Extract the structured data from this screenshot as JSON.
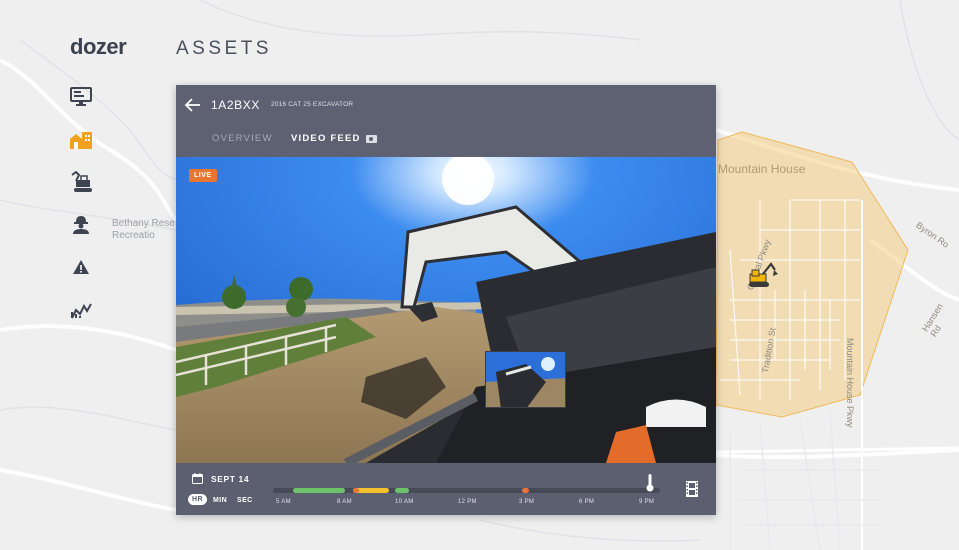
{
  "app": {
    "brand": "dozer",
    "page_title": "ASSETS"
  },
  "nav": {
    "items": [
      {
        "name": "monitor-icon",
        "active": false
      },
      {
        "name": "buildings-icon",
        "active": true
      },
      {
        "name": "excavator-icon",
        "active": false
      },
      {
        "name": "worker-icon",
        "active": false
      },
      {
        "name": "warning-icon",
        "active": false
      },
      {
        "name": "analytics-icon",
        "active": false
      }
    ]
  },
  "map": {
    "labels": {
      "mountain_house": "Mountain House",
      "bethany_1": "Bethany Rese",
      "bethany_2": "Recreatio",
      "byron": "Byron Ro",
      "central_pkwy": "Central Pkwy",
      "hansen": "Hansen Rd",
      "tradition": "Tradition St",
      "mountain_house_pkwy": "Mountain House Pkwy"
    },
    "geofence_color": "#f5c56a",
    "marker_icon": "excavator-marker-icon"
  },
  "panel": {
    "asset_id": "1A2BXX",
    "asset_description": "2016 CAT 25 EXCAVATOR",
    "tabs": {
      "overview": "OVERVIEW",
      "video_feed": "VIDEO FEED"
    },
    "live_badge": "LIVE",
    "timeline": {
      "date": "SEPT 14",
      "units": {
        "hr": "HR",
        "min": "MIN",
        "sec": "SEC"
      },
      "ticks": [
        "5 AM",
        "8 AM",
        "10 AM",
        "12 PM",
        "3 PM",
        "6 PM",
        "9 PM"
      ],
      "colors": {
        "green": "#6cc36a",
        "yellow": "#f3c02e",
        "orange": "#e8743a"
      }
    }
  }
}
